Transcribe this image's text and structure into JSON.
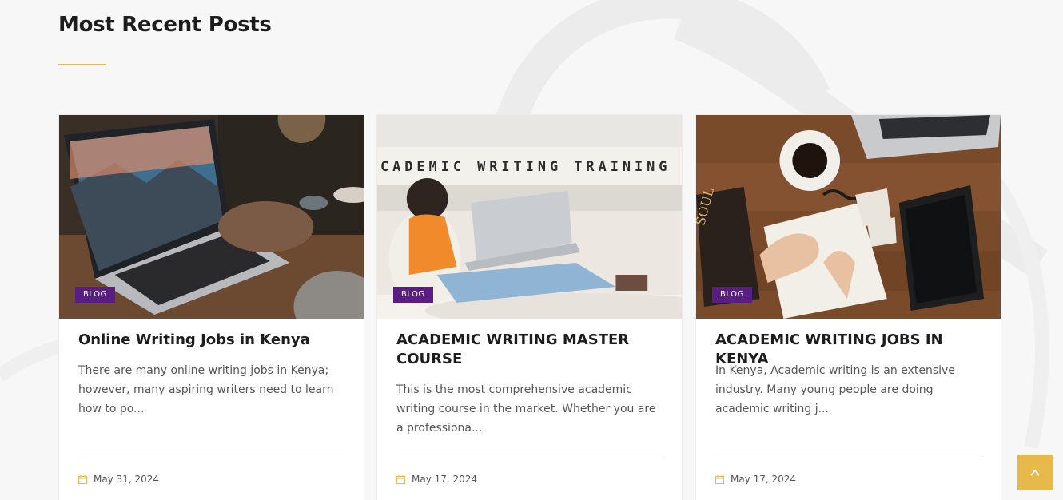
{
  "section": {
    "title": "Most Recent Posts"
  },
  "colors": {
    "accent": "#e7b94b",
    "badge": "#5a1e82"
  },
  "posts": [
    {
      "image_icon": "laptop-photo",
      "category": "BLOG",
      "title": "Online Writing Jobs in Kenya",
      "excerpt": "There are many online writing jobs in Kenya; however, many aspiring writers need to learn how to po...",
      "date": "May 31, 2024"
    },
    {
      "image_icon": "woman-on-couch-photo",
      "image_text": "CADEMIC WRITING TRAINING",
      "category": "BLOG",
      "title": "ACADEMIC WRITING MASTER COURSE",
      "excerpt": "This is the most comprehensive academic writing course in the market. Whether you are a professiona...",
      "date": "May 17, 2024"
    },
    {
      "image_icon": "desk-flatlay-photo",
      "image_text": "SOUL",
      "category": "BLOG",
      "title": "ACADEMIC WRITING JOBS IN KENYA",
      "excerpt": "In Kenya, Academic writing is an extensive industry. Many young people are doing academic writing j...",
      "date": "May 17, 2024"
    }
  ],
  "scroll_top_icon": "chevron-up-icon"
}
